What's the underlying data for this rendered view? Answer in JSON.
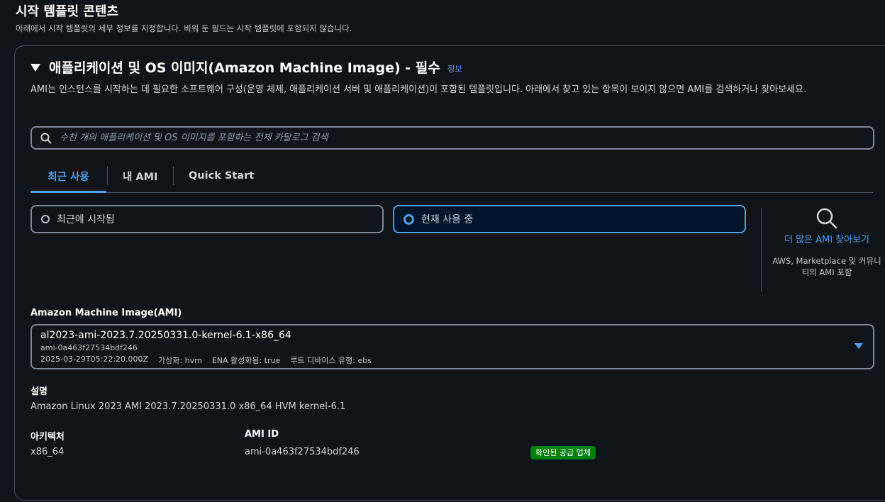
{
  "page": {
    "title": "시작 템플릿 콘텐츠",
    "description": "아래에서 시작 템플릿의 세부 정보를 지정합니다. 비워 둔 필드는 시작 템플릿에 포함되지 않습니다."
  },
  "section": {
    "title": "애플리케이션 및 OS 이미지(Amazon Machine Image) - 필수",
    "info_link": "정보",
    "description": "AMI는 인스턴스를 시작하는 데 필요한 소프트웨어 구성(운영 체제, 애플리케이션 서버 및 애플리케이션)이 포함된 템플릿입니다. 아래에서 찾고 있는 항목이 보이지 않으면 AMI를 검색하거나 찾아보세요."
  },
  "search": {
    "placeholder": "수천 개의 애플리케이션 및 OS 이미지를 포함하는 전체 카탈로그 검색",
    "value": ""
  },
  "tabs": [
    {
      "label": "최근 사용",
      "active": true
    },
    {
      "label": "내 AMI",
      "active": false
    },
    {
      "label": "Quick Start",
      "active": false
    }
  ],
  "radio_options": [
    {
      "label": "최근에 시작됨",
      "selected": false
    },
    {
      "label": "현재 사용 중",
      "selected": true
    }
  ],
  "browse": {
    "link": "더 많은 AMI 찾아보기",
    "note": "AWS, Marketplace 및 커뮤니티의 AMI 포함"
  },
  "ami": {
    "label": "Amazon Machine Image(AMI)",
    "name": "al2023-ami-2023.7.20250331.0-kernel-6.1-x86_64",
    "id": "ami-0a463f27534bdf246",
    "timestamp": "2025-03-29T05:22:20.000Z",
    "virtualization": "가상화: hvm",
    "ena": "ENA 활성화됨: true",
    "root_device": "루트 디바이스 유형: ebs"
  },
  "details": {
    "description_label": "설명",
    "description_value": "Amazon Linux 2023 AMI 2023.7.20250331.0 x86_64 HVM kernel-6.1",
    "arch_label": "아키텍처",
    "arch_value": "x86_64",
    "amiid_label": "AMI ID",
    "amiid_value": "ami-0a463f27534bdf246",
    "badge": "확인된 공급 업체"
  },
  "colors": {
    "accent": "#539fe5",
    "background": "#0f141a",
    "badge": "#037f0c"
  }
}
